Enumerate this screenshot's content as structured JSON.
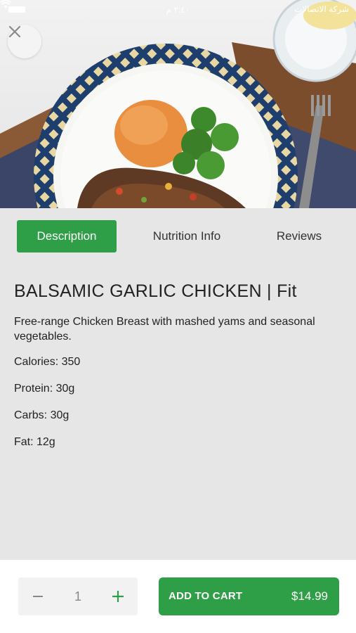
{
  "status_bar": {
    "time": "٢:٤٠ م",
    "carrier": "شركة الاتصالات"
  },
  "header": {
    "close_icon": "close-icon"
  },
  "tabs": [
    {
      "label": "Description",
      "active": true
    },
    {
      "label": "Nutrition Info",
      "active": false
    },
    {
      "label": "Reviews",
      "active": false
    }
  ],
  "product": {
    "title": "BALSAMIC GARLIC CHICKEN | Fit",
    "description": "Free-range Chicken Breast with mashed yams and seasonal vegetables.",
    "facts": [
      "Calories: 350",
      "Protein: 30g",
      "Carbs: 30g",
      "Fat: 12g"
    ]
  },
  "cart": {
    "quantity": "1",
    "minus_icon": "minus-icon",
    "plus_icon": "plus-icon",
    "button_label": "ADD TO CART",
    "price": "$14.99"
  },
  "colors": {
    "accent": "#2f9f47",
    "background": "#e6e6e6"
  }
}
